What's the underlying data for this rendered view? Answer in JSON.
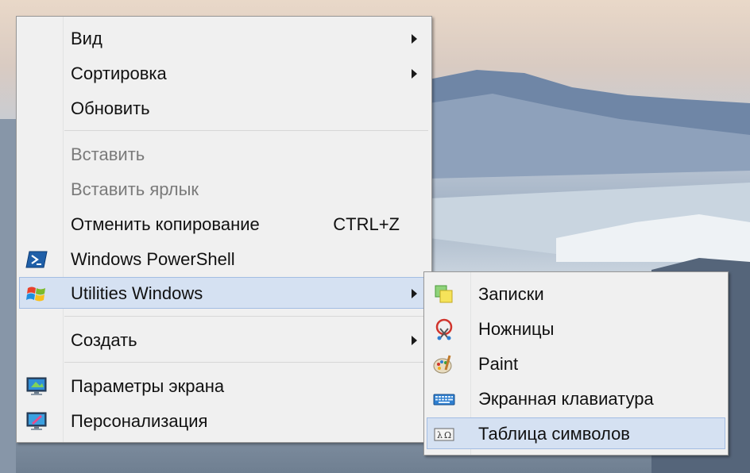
{
  "context_menu": {
    "items": [
      {
        "label": "Вид",
        "submenu": true,
        "enabled": true
      },
      {
        "label": "Сортировка",
        "submenu": true,
        "enabled": true
      },
      {
        "label": "Обновить",
        "submenu": false,
        "enabled": true
      },
      {
        "label": "Вставить",
        "submenu": false,
        "enabled": false
      },
      {
        "label": "Вставить ярлык",
        "submenu": false,
        "enabled": false
      },
      {
        "label": "Отменить копирование",
        "shortcut": "CTRL+Z",
        "submenu": false,
        "enabled": true
      },
      {
        "label": "Windows PowerShell",
        "icon": "powershell-icon",
        "submenu": false,
        "enabled": true
      },
      {
        "label": "Utilities Windows",
        "icon": "windows-logo-icon",
        "submenu": true,
        "enabled": true,
        "highlighted": true
      },
      {
        "label": "Создать",
        "submenu": true,
        "enabled": true
      },
      {
        "label": "Параметры экрана",
        "icon": "display-settings-icon",
        "submenu": false,
        "enabled": true
      },
      {
        "label": "Персонализация",
        "icon": "personalization-icon",
        "submenu": false,
        "enabled": true
      }
    ]
  },
  "submenu": {
    "items": [
      {
        "label": "Записки",
        "icon": "sticky-notes-icon"
      },
      {
        "label": "Ножницы",
        "icon": "snipping-tool-icon"
      },
      {
        "label": "Paint",
        "icon": "paint-icon"
      },
      {
        "label": "Экранная клавиатура",
        "icon": "on-screen-keyboard-icon"
      },
      {
        "label": "Таблица символов",
        "icon": "character-map-icon",
        "highlighted": true
      }
    ]
  },
  "colors": {
    "menu_bg": "#f0f0f0",
    "highlight_bg": "#d5e1f2",
    "highlight_border": "#a3bde3",
    "disabled_text": "#7a7a7a"
  }
}
